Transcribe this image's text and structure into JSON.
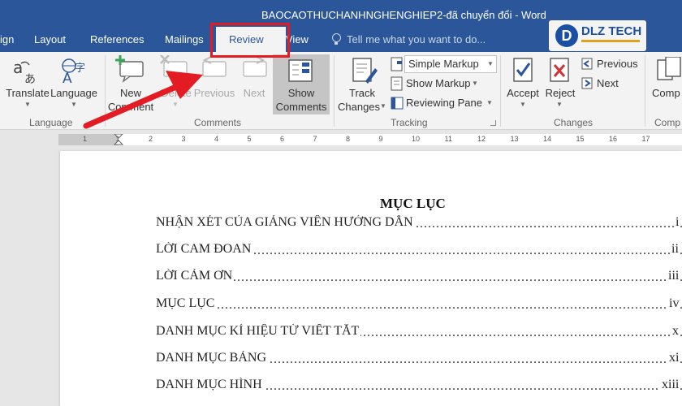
{
  "window": {
    "title": "BAOCAOTHUCHANHNGHENGHIEP2-đã chuyển đổi - Word"
  },
  "tabs": {
    "design": "ign",
    "layout": "Layout",
    "references": "References",
    "mailings": "Mailings",
    "review": "Review",
    "view": "View",
    "tell_me": "Tell me what you want to do..."
  },
  "logo": {
    "letter": "D",
    "text": "DLZ TECH"
  },
  "ribbon": {
    "language": {
      "translate": "Translate",
      "language": "Language",
      "group": "Language"
    },
    "comments": {
      "new_line1": "New",
      "new_line2": "Comment",
      "delete": "Delete",
      "previous": "Previous",
      "next": "Next",
      "show_line1": "Show",
      "show_line2": "Comments",
      "group": "Comments"
    },
    "tracking": {
      "track_line1": "Track",
      "track_line2": "Changes",
      "markup_select": "Simple Markup",
      "show_markup": "Show Markup",
      "reviewing_pane": "Reviewing Pane",
      "group": "Tracking"
    },
    "changes": {
      "accept": "Accept",
      "reject": "Reject",
      "previous": "Previous",
      "next": "Next",
      "group": "Changes"
    },
    "compare": {
      "label": "Comp",
      "group": "Comp"
    }
  },
  "ruler": {
    "numbers": [
      "1",
      "1",
      "2",
      "3",
      "4",
      "5",
      "6",
      "7",
      "8",
      "9",
      "10",
      "11",
      "12",
      "13",
      "14",
      "15",
      "16",
      "17"
    ]
  },
  "document": {
    "toc_title": "MỤC LỤC",
    "toc": [
      {
        "label": "NHẬN XÉT CỦA GIẢNG VIÊN HƯỚNG DẪN",
        "page": "i"
      },
      {
        "label": "LỜI CAM ĐOAN",
        "page": "ii"
      },
      {
        "label": "LỜI CẢM ƠN",
        "page": "iii"
      },
      {
        "label": "MỤC LỤC",
        "page": "iv"
      },
      {
        "label": "DANH MỤC KÍ HIỆU TỪ VIẾT TẮT",
        "page": "x"
      },
      {
        "label": "DANH MỤC BẢNG",
        "page": "xi"
      },
      {
        "label": "DANH MỤC HÌNH",
        "page": "xiii"
      }
    ]
  },
  "colors": {
    "word_blue": "#2b579a",
    "highlight_red": "#e31b23"
  }
}
